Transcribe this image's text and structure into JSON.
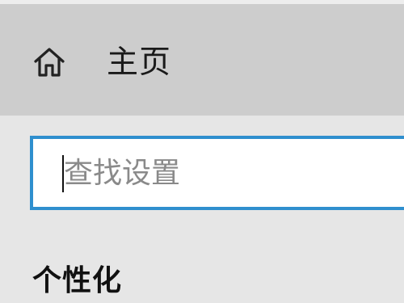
{
  "nav": {
    "home_icon": "home-icon",
    "home_label": "主页"
  },
  "search": {
    "placeholder": "查找设置",
    "value": ""
  },
  "section": {
    "heading": "个性化"
  },
  "colors": {
    "accent": "#2f8fce",
    "nav_background": "#cdcdcd",
    "page_background": "#e6e6e6"
  }
}
